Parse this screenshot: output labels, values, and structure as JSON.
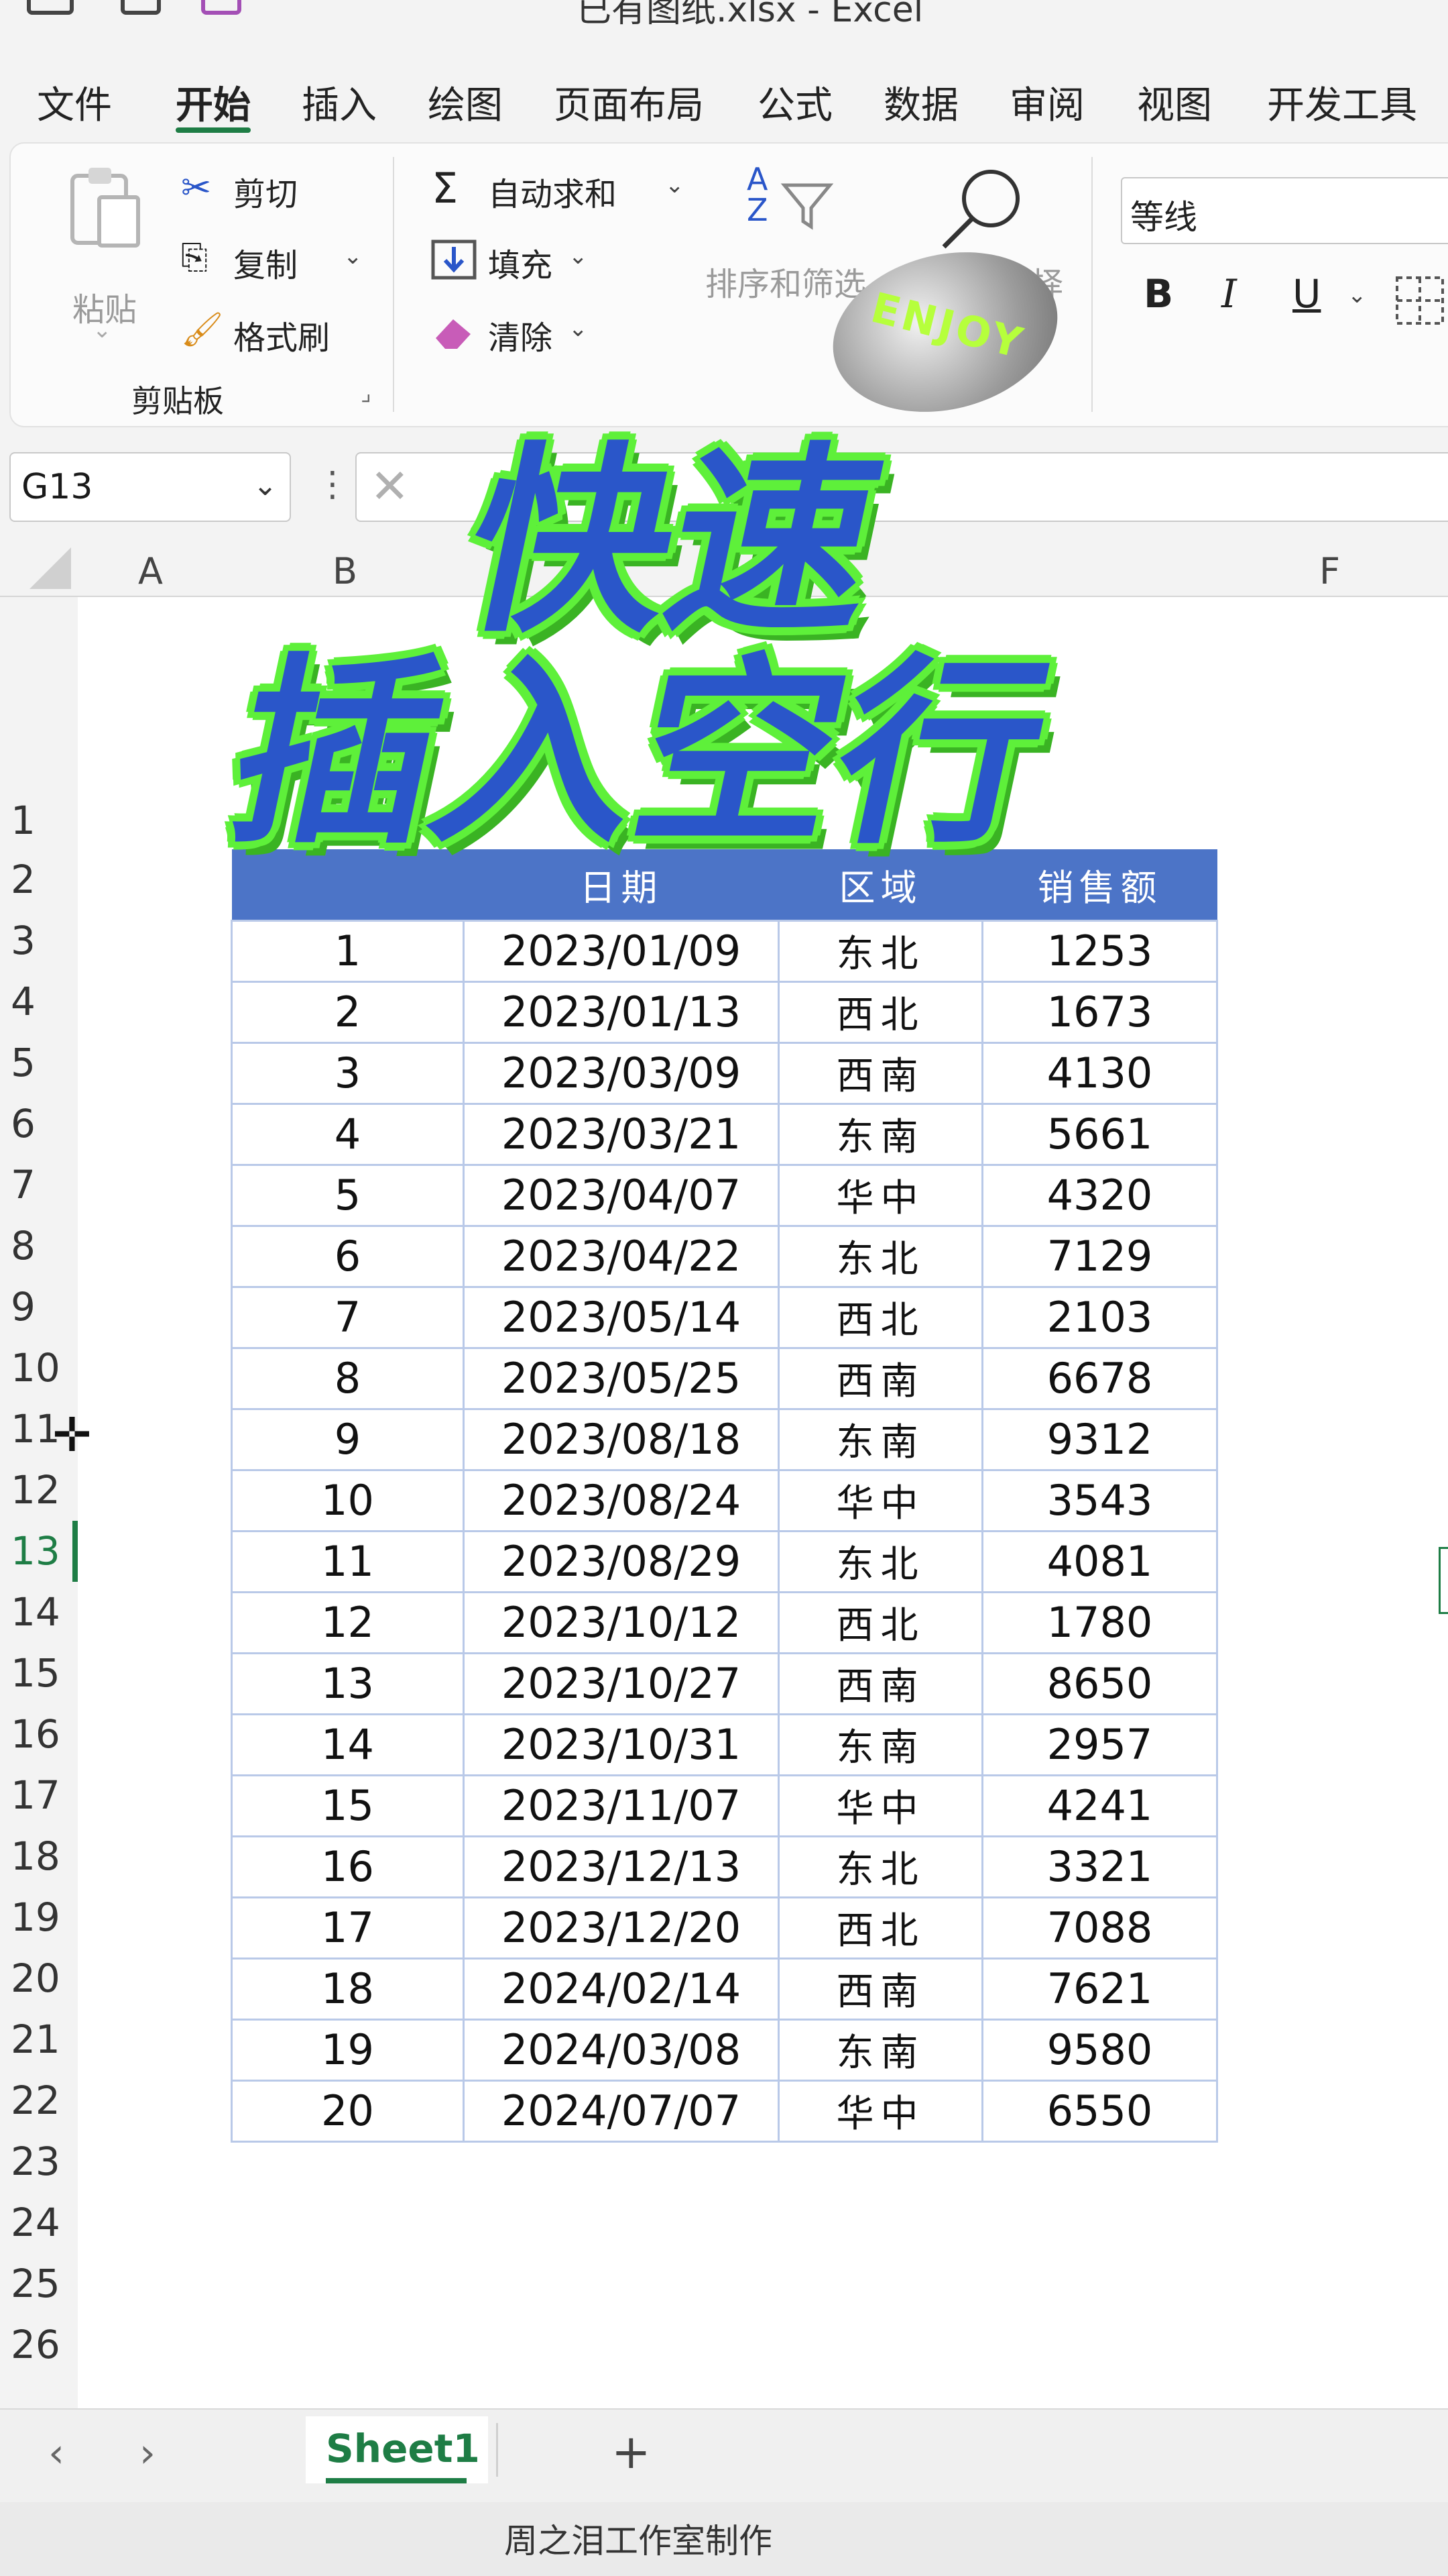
{
  "app": {
    "title": "已有图纸.xlsx - Excel"
  },
  "ribbon_tabs": [
    "文件",
    "开始",
    "插入",
    "绘图",
    "页面布局",
    "公式",
    "数据",
    "审阅",
    "视图",
    "开发工具"
  ],
  "ribbon_tabs_active_index": 1,
  "clipboard": {
    "paste_label": "粘贴",
    "cut_label": "剪切",
    "copy_label": "复制",
    "format_painter_label": "格式刷",
    "group_label": "剪贴板"
  },
  "editing": {
    "autosum_label": "自动求和",
    "fill_label": "填充",
    "clear_label": "清除",
    "sort_filter_label": "排序和筛选",
    "find_select_label": "查找和选择"
  },
  "font": {
    "name": "等线",
    "bold_label": "B",
    "italic_label": "I",
    "underline_label": "U"
  },
  "formula_bar": {
    "name_box": "G13",
    "formula": ""
  },
  "columns": [
    "A",
    "B",
    "F"
  ],
  "row_numbers": [
    "1",
    "2",
    "3",
    "4",
    "5",
    "6",
    "7",
    "8",
    "9",
    "10",
    "11",
    "12",
    "13",
    "14",
    "15",
    "16",
    "17",
    "18",
    "19",
    "20",
    "21",
    "22",
    "23",
    "24",
    "25",
    "26"
  ],
  "selected_row": "13",
  "table": {
    "headers": [
      "",
      "日期",
      "区域",
      "销售额"
    ],
    "rows": [
      [
        "1",
        "2023/01/09",
        "东北",
        "1253"
      ],
      [
        "2",
        "2023/01/13",
        "西北",
        "1673"
      ],
      [
        "3",
        "2023/03/09",
        "西南",
        "4130"
      ],
      [
        "4",
        "2023/03/21",
        "东南",
        "5661"
      ],
      [
        "5",
        "2023/04/07",
        "华中",
        "4320"
      ],
      [
        "6",
        "2023/04/22",
        "东北",
        "7129"
      ],
      [
        "7",
        "2023/05/14",
        "西北",
        "2103"
      ],
      [
        "8",
        "2023/05/25",
        "西南",
        "6678"
      ],
      [
        "9",
        "2023/08/18",
        "东南",
        "9312"
      ],
      [
        "10",
        "2023/08/24",
        "华中",
        "3543"
      ],
      [
        "11",
        "2023/08/29",
        "东北",
        "4081"
      ],
      [
        "12",
        "2023/10/12",
        "西北",
        "1780"
      ],
      [
        "13",
        "2023/10/27",
        "西南",
        "8650"
      ],
      [
        "14",
        "2023/10/31",
        "东南",
        "2957"
      ],
      [
        "15",
        "2023/11/07",
        "华中",
        "4241"
      ],
      [
        "16",
        "2023/12/13",
        "东北",
        "3321"
      ],
      [
        "17",
        "2023/12/20",
        "西北",
        "7088"
      ],
      [
        "18",
        "2024/02/14",
        "西南",
        "7621"
      ],
      [
        "19",
        "2024/03/08",
        "东南",
        "9580"
      ],
      [
        "20",
        "2024/07/07",
        "华中",
        "6550"
      ]
    ]
  },
  "overlay": {
    "line1": "快速",
    "line2": "插入空行",
    "sticker": "ENJOY"
  },
  "sheet_tabs": [
    "Sheet1"
  ],
  "add_sheet_label": "+",
  "status_text": "周之泪工作室制作",
  "colors": {
    "accent": "#1e7d45",
    "table_header": "#4c74c7",
    "table_border": "#b9c9e8",
    "overlay_fill": "#2a56c9",
    "overlay_outline": "#5ef03a"
  }
}
